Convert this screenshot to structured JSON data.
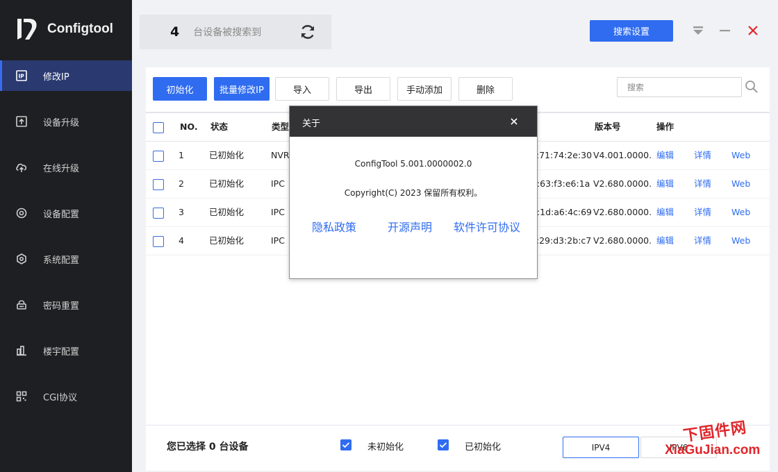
{
  "app": {
    "name": "Configtool"
  },
  "sidebar": {
    "items": [
      {
        "label": "修改IP",
        "icon": "ip-icon",
        "active": true
      },
      {
        "label": "设备升级",
        "icon": "upgrade-icon"
      },
      {
        "label": "在线升级",
        "icon": "cloud-upload-icon"
      },
      {
        "label": "设备配置",
        "icon": "device-config-icon"
      },
      {
        "label": "系统配置",
        "icon": "system-config-icon"
      },
      {
        "label": "密码重置",
        "icon": "password-reset-icon"
      },
      {
        "label": "楼宇配置",
        "icon": "building-config-icon"
      },
      {
        "label": "CGI协议",
        "icon": "cgi-icon"
      }
    ]
  },
  "header": {
    "device_count": "4",
    "device_count_label": "台设备被搜索到",
    "search_settings_label": "搜索设置"
  },
  "toolbar": {
    "init_label": "初始化",
    "batch_modify_label": "批量修改IP",
    "import_label": "导入",
    "export_label": "导出",
    "manual_add_label": "手动添加",
    "delete_label": "删除",
    "search_placeholder": "搜索"
  },
  "table": {
    "headers": {
      "no": "NO.",
      "status": "状态",
      "type": "类型",
      "version": "版本号",
      "action": "操作"
    },
    "rows": [
      {
        "no": "1",
        "status": "已初始化",
        "type": "NVR",
        "mac": "c:71:74:2e:30",
        "version": "V4.001.0000...",
        "edit": "编辑",
        "detail": "详情",
        "web": "Web"
      },
      {
        "no": "2",
        "status": "已初始化",
        "type": "IPC",
        "mac": "4:63:f3:e6:1a",
        "version": "V2.680.0000...",
        "edit": "编辑",
        "detail": "详情",
        "web": "Web"
      },
      {
        "no": "3",
        "status": "已初始化",
        "type": "IPC",
        "mac": "d:1d:a6:4c:69",
        "version": "V2.680.0000...",
        "edit": "编辑",
        "detail": "详情",
        "web": "Web"
      },
      {
        "no": "4",
        "status": "已初始化",
        "type": "IPC",
        "mac": "c:29:d3:2b:c7",
        "version": "V2.680.0000...",
        "edit": "编辑",
        "detail": "详情",
        "web": "Web"
      }
    ]
  },
  "footer": {
    "selected_prefix": "您已选择",
    "selected_count": "0",
    "selected_suffix": "台设备",
    "uninit_label": "未初始化",
    "init_label": "已初始化",
    "ipv4_label": "IPV4",
    "ipv6_label": "IPV6"
  },
  "dialog": {
    "title": "关于",
    "version": "ConfigTool 5.001.0000002.0",
    "copyright": "Copyright(C) 2023 保留所有权利。",
    "privacy_label": "隐私政策",
    "opensource_label": "开源声明",
    "license_label": "软件许可协议"
  },
  "watermark": {
    "top": "下固件网",
    "bottom": "XiaGuJian.com"
  },
  "colors": {
    "accent": "#2f6cf0",
    "sidebar_bg": "#1e1f22",
    "active_nav": "#2a3a70",
    "close_red": "#e0262b"
  }
}
